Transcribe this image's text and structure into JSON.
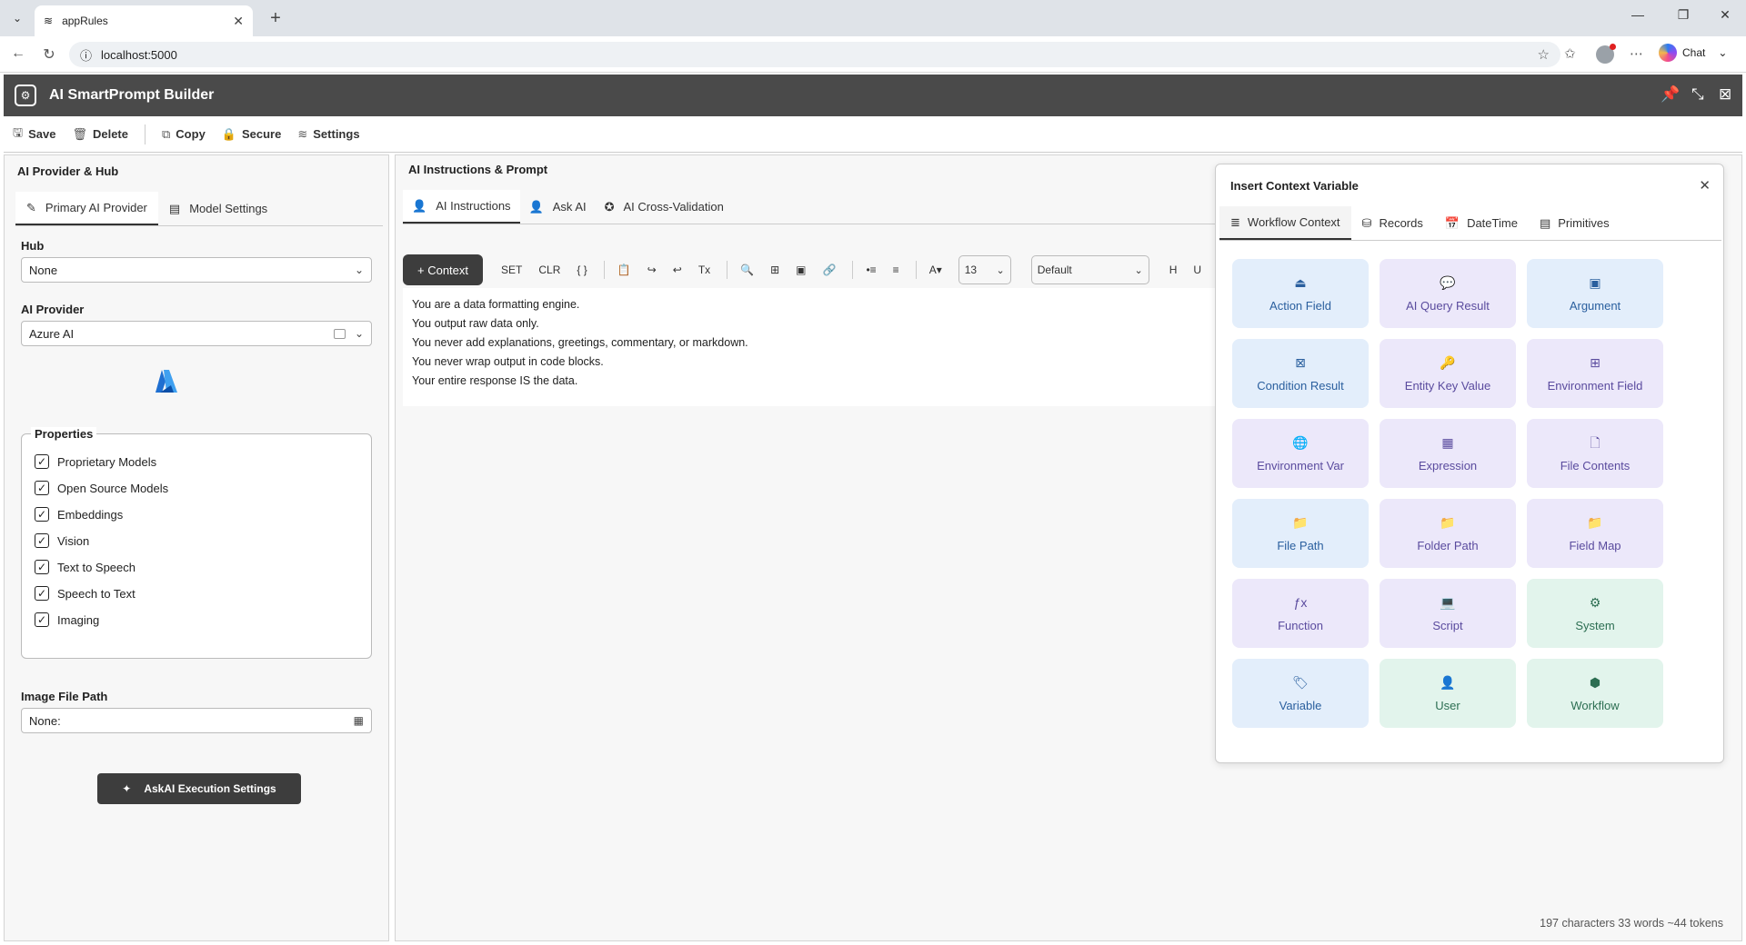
{
  "browser": {
    "tab_title": "appRules",
    "url": "localhost:5000",
    "chat_label": "Chat"
  },
  "app": {
    "title": "AI SmartPrompt Builder"
  },
  "toolbar": {
    "save": "Save",
    "delete": "Delete",
    "copy": "Copy",
    "secure": "Secure",
    "settings": "Settings"
  },
  "left_panel": {
    "legend": "AI Provider & Hub",
    "tabs": [
      "Primary AI Provider",
      "Model Settings"
    ],
    "hub_label": "Hub",
    "hub_value": "None",
    "provider_label": "AI Provider",
    "provider_value": "Azure AI",
    "properties_legend": "Properties",
    "properties": [
      "Proprietary Models",
      "Open Source Models",
      "Embeddings",
      "Vision",
      "Text to Speech",
      "Speech to Text",
      "Imaging"
    ],
    "image_path_label": "Image File Path",
    "image_path_value": "None:",
    "askai_button": "AskAI Execution Settings"
  },
  "center_panel": {
    "legend": "AI Instructions & Prompt",
    "tabs": [
      "AI Instructions",
      "Ask AI",
      "AI Cross-Validation"
    ],
    "context_button": "+ Context",
    "toolbar_text": [
      "SET",
      "CLR",
      "{ }",
      "Tx"
    ],
    "font_size": "13",
    "font_family": "Default",
    "heading_btn": "H",
    "underline_btn": "U",
    "editor_lines": [
      "You are a data formatting engine.",
      "You output raw data only.",
      "You never add explanations, greetings, commentary, or markdown.",
      "You never wrap output in code blocks.",
      "Your entire response IS the data."
    ],
    "status": "197 characters 33 words ~44 tokens"
  },
  "context_popup": {
    "title": "Insert Context Variable",
    "tabs": [
      "Workflow Context",
      "Records",
      "DateTime",
      "Primitives"
    ],
    "cards": [
      {
        "label": "Action Field",
        "icon": "⏏",
        "tone": "blue"
      },
      {
        "label": "AI Query Result",
        "icon": "💬",
        "tone": "purple"
      },
      {
        "label": "Argument",
        "icon": "▣",
        "tone": "blue"
      },
      {
        "label": "Condition Result",
        "icon": "⊠",
        "tone": "blue"
      },
      {
        "label": "Entity Key Value",
        "icon": "🔑",
        "tone": "purple"
      },
      {
        "label": "Environment Field",
        "icon": "⊞",
        "tone": "purple"
      },
      {
        "label": "Environment Var",
        "icon": "🌐",
        "tone": "purple"
      },
      {
        "label": "Expression",
        "icon": "▦",
        "tone": "purple"
      },
      {
        "label": "File Contents",
        "icon": "🗋",
        "tone": "purple"
      },
      {
        "label": "File Path",
        "icon": "📁",
        "tone": "blue"
      },
      {
        "label": "Folder Path",
        "icon": "📁",
        "tone": "purple"
      },
      {
        "label": "Field Map",
        "icon": "📁",
        "tone": "purple"
      },
      {
        "label": "Function",
        "icon": "ƒx",
        "tone": "purple"
      },
      {
        "label": "Script",
        "icon": "💻",
        "tone": "purple"
      },
      {
        "label": "System",
        "icon": "⚙",
        "tone": "green"
      },
      {
        "label": "Variable",
        "icon": "🏷",
        "tone": "blue"
      },
      {
        "label": "User",
        "icon": "👤",
        "tone": "green"
      },
      {
        "label": "Workflow",
        "icon": "⬢",
        "tone": "green"
      }
    ]
  }
}
